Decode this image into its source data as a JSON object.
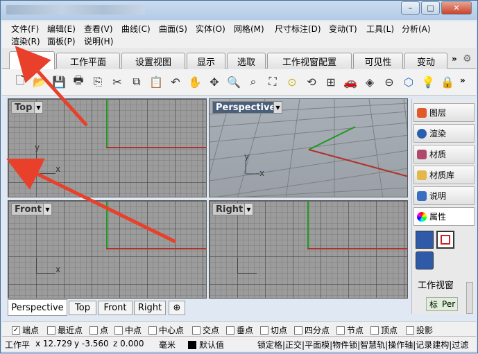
{
  "window": {
    "buttons": {
      "minimize": "–",
      "maximize": "□",
      "close": "✕"
    }
  },
  "menu": {
    "row1": [
      "文件(F)",
      "编辑(E)",
      "查看(V)",
      "曲线(C)",
      "曲面(S)",
      "实体(O)",
      "网格(M)",
      "尺寸标注(D)",
      "变动(T)",
      "工具(L)",
      "分析(A)"
    ],
    "row2": [
      "渲染(R)",
      "面板(P)",
      "说明(H)"
    ]
  },
  "tabs": [
    "标准",
    "工作平面",
    "设置视图",
    "显示",
    "选取",
    "工作视窗配置",
    "可见性",
    "变动"
  ],
  "tab_overflow": "»",
  "toolbar_icons": [
    "new-file-icon",
    "open-folder-icon",
    "save-icon",
    "print-icon",
    "import-icon",
    "cut-icon",
    "copy-icon",
    "paste-icon",
    "undo-icon",
    "pan-hand-icon",
    "rotate-view-icon",
    "zoom-window-icon",
    "zoom-selected-icon",
    "zoom-extents-icon",
    "zoom-target-icon",
    "rotate-3d-icon",
    "four-viewports-icon",
    "car-render-icon",
    "rendered-view-icon",
    "ghosted-icon",
    "gumball-icon",
    "lightbulb-icon",
    "lock-icon"
  ],
  "viewports": {
    "top": {
      "label": "Top",
      "axis_x": "x",
      "axis_y": "y"
    },
    "perspective": {
      "label": "Perspective",
      "axis_x": "x",
      "axis_y": "y"
    },
    "front": {
      "label": "Front",
      "axis_x": "x",
      "axis_y": "z"
    },
    "right": {
      "label": "Right",
      "axis_x": "y",
      "axis_y": "z"
    }
  },
  "viewport_tabs": [
    "Perspective",
    "Top",
    "Front",
    "Right"
  ],
  "viewport_tab_add": "⊕",
  "side_panel": [
    "图层",
    "渲染",
    "材质",
    "材质库",
    "说明",
    "属性"
  ],
  "properties": {
    "section": "工作视窗",
    "field_label": "标",
    "field_value": "Per"
  },
  "snaps": [
    {
      "label": "端点",
      "checked": true
    },
    {
      "label": "最近点",
      "checked": false
    },
    {
      "label": "点",
      "checked": false
    },
    {
      "label": "中点",
      "checked": false
    },
    {
      "label": "中心点",
      "checked": false
    },
    {
      "label": "交点",
      "checked": false
    },
    {
      "label": "垂点",
      "checked": false
    },
    {
      "label": "切点",
      "checked": false
    },
    {
      "label": "四分点",
      "checked": false
    },
    {
      "label": "节点",
      "checked": false
    },
    {
      "label": "顶点",
      "checked": false
    },
    {
      "label": "投影",
      "checked": false
    }
  ],
  "status": {
    "cplane": "工作平",
    "x": "x 12.729",
    "y": "y -3.560",
    "z": "z 0.000",
    "unit": "毫米",
    "layer": "默认值",
    "flags": "锁定格|正交|平面模|物件锁|智慧轨|操作轴|记录建构|过滤"
  },
  "colors": {
    "x_axis": "#b0302a",
    "y_axis": "#1e9a1e",
    "annotation_arrow": "#e8402a"
  }
}
